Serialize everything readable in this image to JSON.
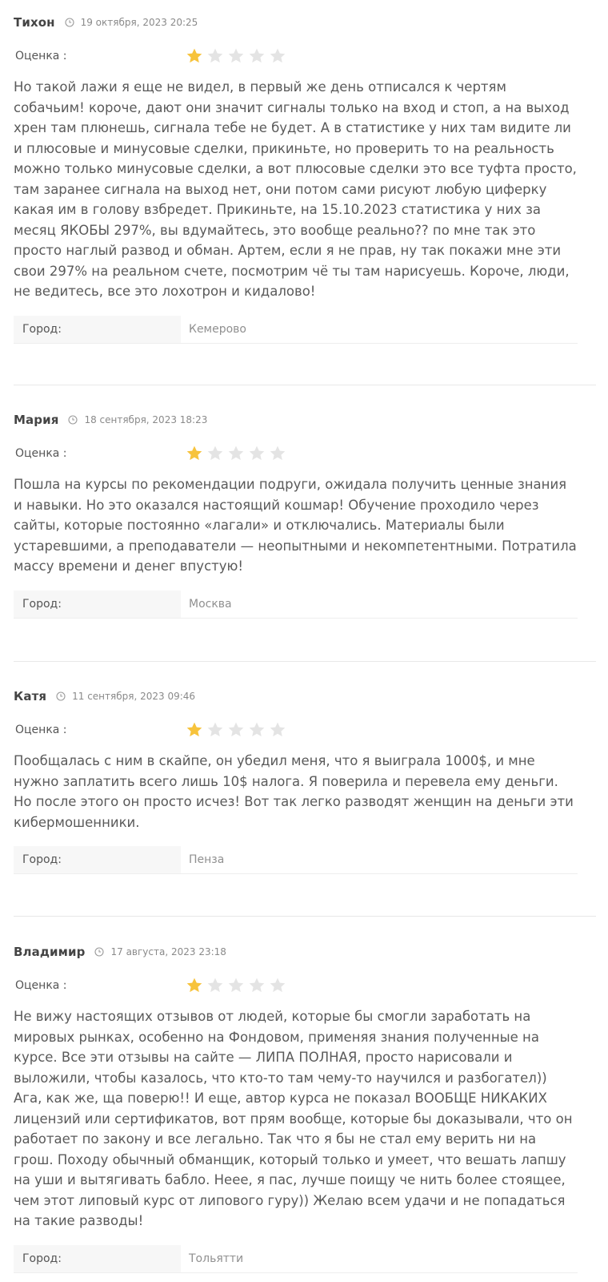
{
  "reviews": [
    {
      "author": "Тихон",
      "date": "19 октября, 2023 20:25",
      "rating_label": "Оценка :",
      "rating": 1,
      "rating_max": 5,
      "text": "Но такой лажи я еще не видел, в первый же день отписался к чертям собачьим! короче, дают они значит сигналы только на вход и стоп, а на выход хрен там плюнешь, сигнала тебе не будет. А в статистике у них там видите ли и плюсовые и минусовые сделки, прикиньте, но проверить то на реальность можно только минусовые сделки, а вот плюсовые сделки это все туфта просто, там заранее сигнала на выход нет, они потом сами рисуют любую циферку какая им в голову взбредет. Прикиньте, на 15.10.2023 статистика у них за месяц ЯКОБЫ 297%, вы вдумайтесь, это вообще реально?? по мне так это просто наглый развод и обман. Артем, если я не прав, ну так покажи мне эти свои 297% на реальном счете, посмотрим чё ты там нарисуешь. Короче, люди, не ведитесь, все это лохотрон и кидалово!",
      "city_label": "Город:",
      "city": "Кемерово"
    },
    {
      "author": "Мария",
      "date": "18 сентября, 2023 18:23",
      "rating_label": "Оценка :",
      "rating": 1,
      "rating_max": 5,
      "text": "Пошла на курсы по рекомендации подруги, ожидала получить ценные знания и навыки. Но это оказался настоящий кошмар! Обучение проходило через сайты, которые постоянно «лагали» и отключались. Материалы были устаревшими, а преподаватели — неопытными и некомпетентными. Потратила массу времени и денег впустую!",
      "city_label": "Город:",
      "city": "Москва"
    },
    {
      "author": "Катя",
      "date": "11 сентября, 2023 09:46",
      "rating_label": "Оценка :",
      "rating": 1,
      "rating_max": 5,
      "text": "Пообщалась с ним в скайпе, он убедил меня, что я выиграла 1000$, и мне нужно заплатить всего лишь 10$ налога. Я поверила и перевела ему деньги. Но после этого он просто исчез! Вот так легко разводят женщин на деньги эти кибермошенники.",
      "city_label": "Город:",
      "city": "Пенза"
    },
    {
      "author": "Владимир",
      "date": "17 августа, 2023 23:18",
      "rating_label": "Оценка :",
      "rating": 1,
      "rating_max": 5,
      "text": "Не вижу настоящих отзывов от людей, которые бы смогли заработать на мировых рынках, особенно на Фондовом, применяя знания полученные на курсе. Все эти отзывы на сайте — ЛИПА ПОЛНАЯ, просто нарисовали и выложили, чтобы казалось, что кто-то там чему-то научился и разбогател)) Ага, как же, ща поверю!! И еще, автор курса не показал ВООБЩЕ НИКАКИХ лицензий или сертификатов, вот прям вообще, которые бы доказывали, что он работает по закону и все легально. Так что я бы не стал ему верить ни на грош. Походу обычный обманщик, который только и умеет, что вешать лапшу на уши и вытягивать бабло. Неее, я пас, лучше поищу че нить более стоящее, чем этот липовый курс от липового гуру)) Желаю всем удачи и не попадаться на такие разводы!",
      "city_label": "Город:",
      "city": "Тольятти"
    }
  ],
  "colors": {
    "star_filled": "#f7c33c",
    "star_empty": "#e4e4e4",
    "author": "#444444",
    "date": "#8a8a8a",
    "text": "#5a5a5a",
    "city_label_bg": "#f7f7f7"
  },
  "icons": {
    "date_icon": "clock-icon",
    "rating_icon": "star-icon"
  }
}
